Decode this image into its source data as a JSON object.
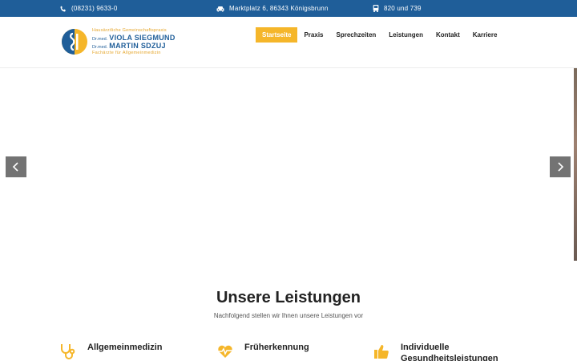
{
  "topbar": {
    "phone": "(08231) 9633-0",
    "address": "Marktplatz 6, 86343 Königsbrunn",
    "bus": "820 und 739",
    "phone_icon": "phone-icon",
    "car_icon": "car-icon",
    "bus_icon": "bus-icon"
  },
  "logo": {
    "line1": "Hausärztliche Gemeinschaftspraxis",
    "dr1": "Dr.med.",
    "name1": "VIOLA SIEGMUND",
    "dr2": "Dr.med.",
    "name2": "MARTIN SDZUJ",
    "line4": "Fachärzte für Allgemeinmedizin"
  },
  "nav": {
    "items": [
      "Startseite",
      "Praxis",
      "Sprechzeiten",
      "Leistungen",
      "Kontakt",
      "Karriere"
    ],
    "active": "Startseite"
  },
  "slider": {
    "prev_icon": "chevron-left-icon",
    "next_icon": "chevron-right-icon"
  },
  "services": {
    "title": "Unsere Leistungen",
    "subtitle": "Nachfolgend stellen wir Ihnen unsere Leistungen vor",
    "items": [
      {
        "title": "Allgemeinmedizin",
        "icon": "stethoscope-icon"
      },
      {
        "title": "Früherkennung",
        "icon": "heart-pulse-icon"
      },
      {
        "title": "Individuelle Gesundheitsleistungen",
        "icon": "thumbs-up-icon"
      }
    ]
  },
  "colors": {
    "brand_blue": "#1f5e99",
    "accent_yellow": "#f5b62a"
  }
}
